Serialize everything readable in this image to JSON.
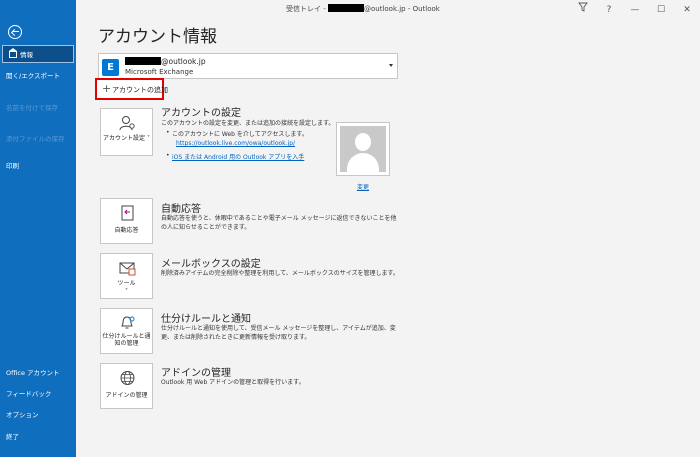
{
  "titlebar": {
    "prefix": "受信トレイ - ",
    "suffix": "@outlook.jp - Outlook",
    "help": "?",
    "minimize": "—",
    "restore": "☐",
    "close": "✕"
  },
  "sidebar": {
    "items": [
      {
        "label": "情報"
      },
      {
        "label": "開く/エクスポート"
      },
      {
        "label": "名前を付けて保存"
      },
      {
        "label": "添付ファイルの保存"
      },
      {
        "label": "印刷"
      },
      {
        "label": "Office アカウント"
      },
      {
        "label": "フィードバック"
      },
      {
        "label": "オプション"
      },
      {
        "label": "終了"
      }
    ]
  },
  "main": {
    "title": "アカウント情報",
    "account": {
      "email_suffix": "@outlook.jp",
      "type": "Microsoft Exchange",
      "icon_letter": "E"
    },
    "add_account": {
      "plus": "+",
      "label": "アカウントの追加"
    },
    "sections": {
      "account_settings": {
        "tile_label": "アカウント設定 ˅",
        "title": "アカウントの設定",
        "desc": "このアカウントの設定を変更、または追加の接続を設定します。",
        "bullet1": "このアカウントに Web を介してアクセスします。",
        "link1": "https://outlook.live.com/owa/outlook.jp/",
        "link2": "iOS または Android 用の Outlook アプリを入手"
      },
      "profile": {
        "change": "変更"
      },
      "auto_reply": {
        "tile_label": "自動応答",
        "title": "自動応答",
        "desc": "自動応答を使うと、休暇中であることや電子メール メッセージに返信できないことを他の人に知らせることができます。"
      },
      "mailbox": {
        "tile_label": "ツール",
        "title": "メールボックスの設定",
        "desc": "削除済みアイテムの完全削除や整理を利用して、メールボックスのサイズを管理します。"
      },
      "rules": {
        "tile_label": "仕分けルールと通知の管理",
        "title": "仕分けルールと通知",
        "desc": "仕分けルールと通知を使用して、受信メール メッセージを整理し、アイテムが追加、変更、または削除されたときに更新情報を受け取ります。"
      },
      "addins": {
        "tile_label": "アドインの管理",
        "title": "アドインの管理",
        "desc": "Outlook 用 Web アドインの管理と取得を行います。"
      }
    }
  }
}
